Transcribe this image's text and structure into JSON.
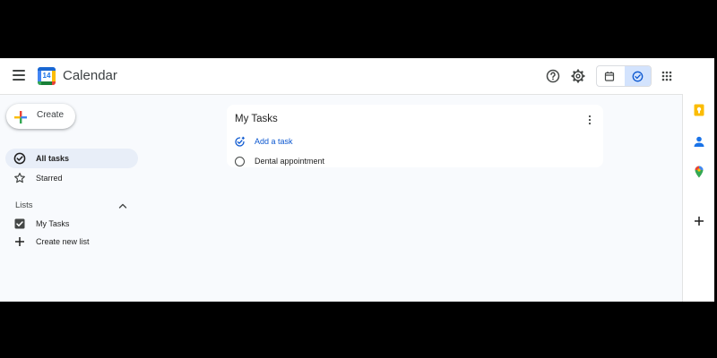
{
  "header": {
    "title": "Calendar",
    "logo_day": "14",
    "icons": [
      "menu-icon",
      "help-icon",
      "settings-icon",
      "calendar-view-icon",
      "tasks-view-icon",
      "apps-grid-icon"
    ]
  },
  "create": {
    "label": "Create"
  },
  "nav": {
    "items": [
      {
        "label": "All tasks",
        "icon": "check-circle-icon",
        "active": true
      },
      {
        "label": "Starred",
        "icon": "star-icon",
        "active": false
      }
    ],
    "lists_label": "Lists",
    "lists": [
      {
        "label": "My Tasks",
        "checked": true
      },
      {
        "label": "Create new list",
        "icon": "plus-icon"
      }
    ]
  },
  "card": {
    "title": "My Tasks",
    "add_task_label": "Add a task",
    "tasks": [
      {
        "title": "Dental appointment"
      }
    ]
  },
  "side_panel": {
    "icons": [
      "keep-icon",
      "contacts-icon",
      "maps-icon",
      "add-icon"
    ]
  },
  "colors": {
    "accent": "#0b57d0",
    "active_view": "#d3e3fd",
    "nav_active": "#e8eef8",
    "keep": "#fbbc04",
    "contacts": "#1a73e8"
  }
}
